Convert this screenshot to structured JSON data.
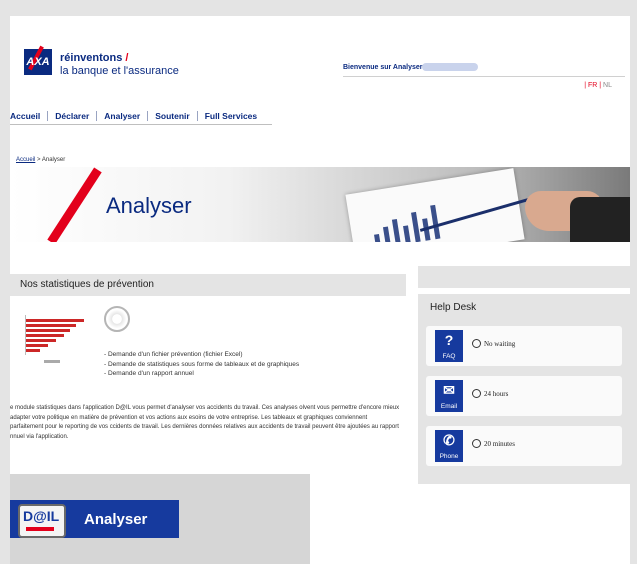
{
  "brand": {
    "logo_text": "AXA",
    "tagline_line1": "réinventons",
    "tagline_slash": "/",
    "tagline_line2": "la banque et l'assurance"
  },
  "header": {
    "welcome": "Bienvenue sur Analyser",
    "lang_fr": "| FR |",
    "lang_nl": "NL"
  },
  "nav": {
    "items": [
      "Accueil",
      "Déclarer",
      "Analyser",
      "Soutenir",
      "Full Services"
    ]
  },
  "breadcrumb": {
    "home": "Accueil",
    "separator": " > ",
    "current": "Analyser"
  },
  "banner": {
    "title": "Analyser"
  },
  "stats": {
    "heading": "Nos statistiques de prévention",
    "list": [
      "- Demande d'un fichier prévention (fichier Excel)",
      "- Demande de statistiques sous forme de tableaux et de graphiques",
      "- Demande d'un rapport annuel"
    ],
    "paragraph": "e module statistiques dans l'application D@IL vous permet d'analyser vos accidents du travail. Ces analyses olvent vous permettre d'encore mieux adapter votre politique en matière de prévention et vos actions aux esoins de votre entreprise. Les tableaux et graphiques conviennent parfaitement pour le reporting de vos ccidents de travail. Les dernières données relatives aux accidents de travail peuvent être ajoutées au rapport nnuel via l'application."
  },
  "cta": {
    "badge": "D@IL",
    "button_label": "Analyser"
  },
  "helpdesk": {
    "heading": "Help Desk",
    "items": [
      {
        "icon": "question-icon",
        "glyph": "?",
        "label": "FAQ",
        "value": "No waiting"
      },
      {
        "icon": "email-icon",
        "glyph": "✉",
        "label": "Email",
        "value": "24 hours"
      },
      {
        "icon": "phone-icon",
        "glyph": "✆",
        "label": "Phone",
        "value": "20 minutes"
      }
    ]
  },
  "colors": {
    "brand_blue": "#0a2a80",
    "accent_red": "#e3001b",
    "button_blue": "#163a9e",
    "panel_gray": "#e4e4e4"
  }
}
